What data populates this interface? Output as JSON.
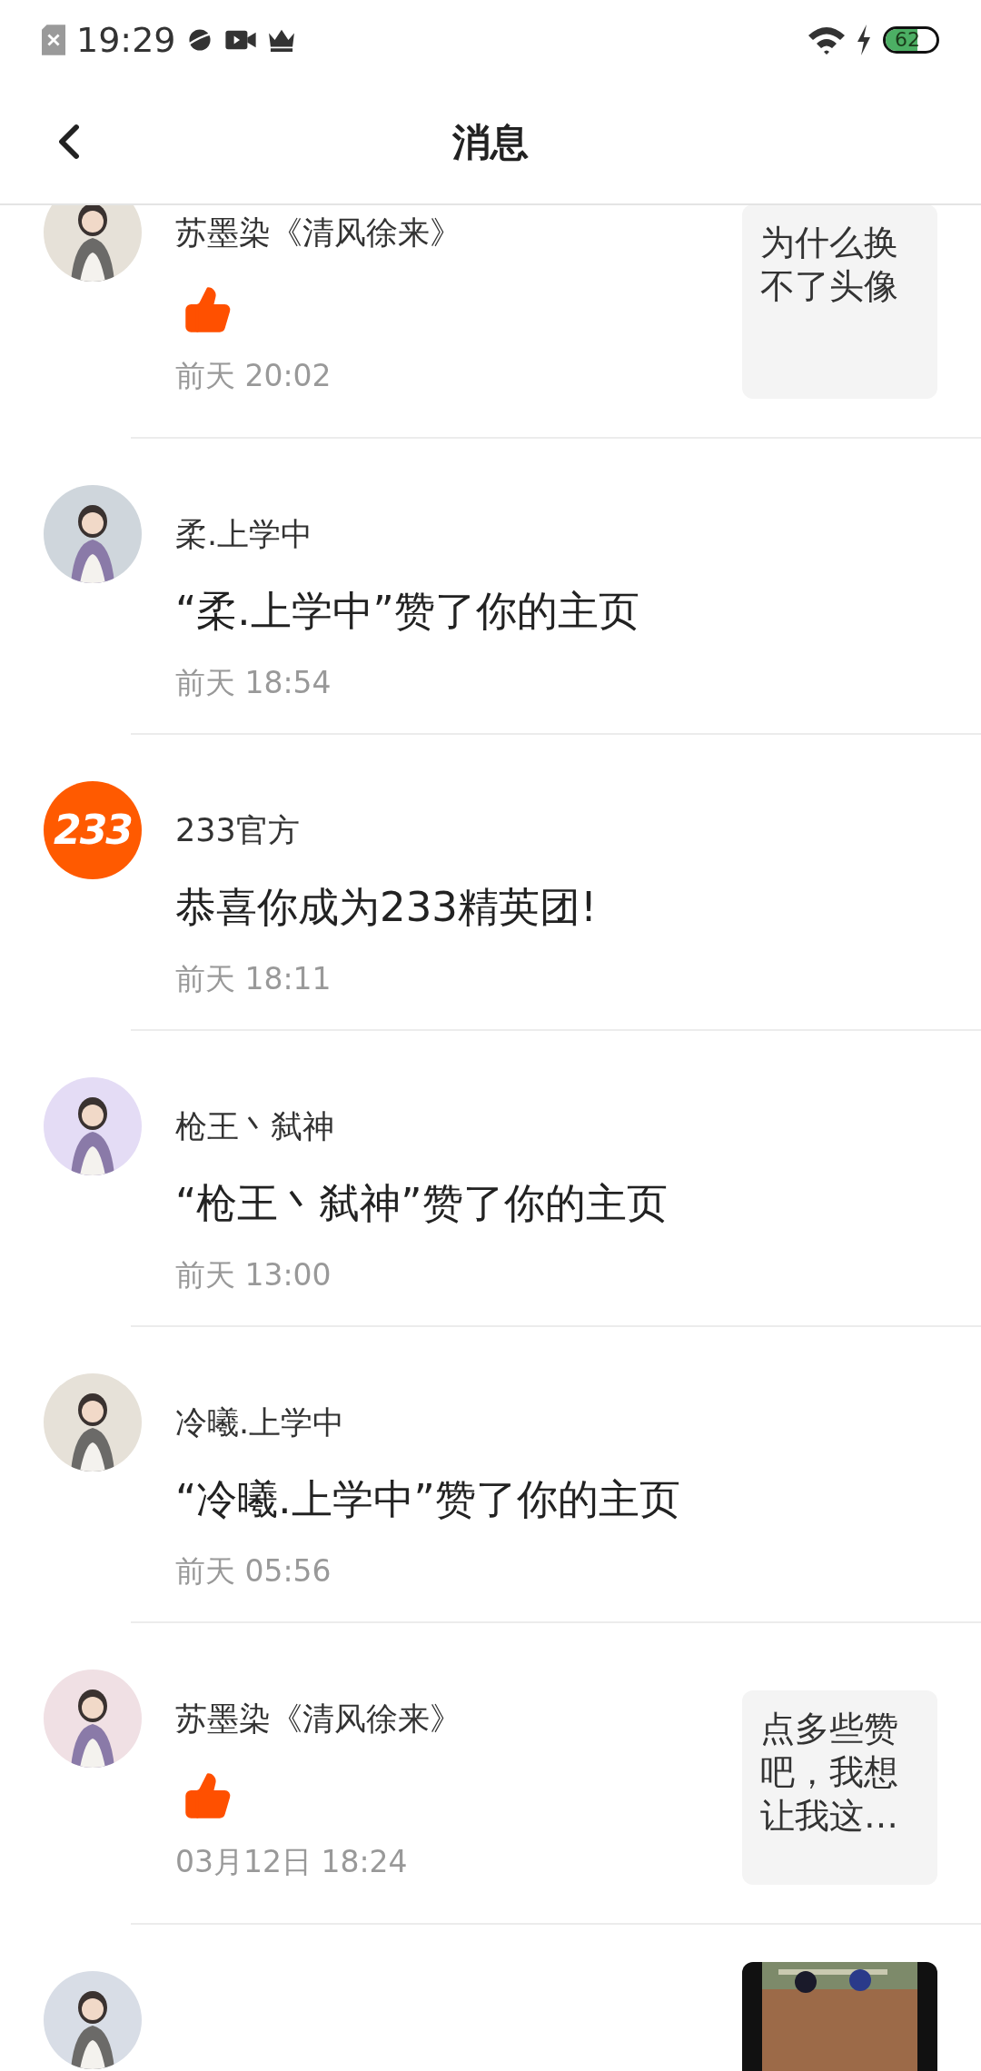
{
  "status_bar": {
    "time": "19:29",
    "battery": "62"
  },
  "header": {
    "title": "消息"
  },
  "messages": [
    {
      "kind": "like",
      "name": "苏墨染《清风徐来》",
      "time": "前天 20:02",
      "quote": "为什么换不了头像"
    },
    {
      "kind": "text",
      "name": "柔.上学中",
      "text": "“柔.上学中”赞了你的主页",
      "time": "前天 18:54"
    },
    {
      "kind": "text",
      "avatar": {
        "kind": "badge",
        "text": "233"
      },
      "name": "233官方",
      "text": "恭喜你成为233精英团!",
      "time": "前天 18:11"
    },
    {
      "kind": "text",
      "name": "枪王丶弑神",
      "text": "“枪王丶弑神”赞了你的主页",
      "time": "前天 13:00"
    },
    {
      "kind": "text",
      "name": "冷曦.上学中",
      "text": "“冷曦.上学中”赞了你的主页",
      "time": "前天 05:56"
    },
    {
      "kind": "like",
      "name": "苏墨染《清风徐来》",
      "time": "03月12日 18:24",
      "quote": "点多些赞吧，我想让我这…"
    }
  ]
}
